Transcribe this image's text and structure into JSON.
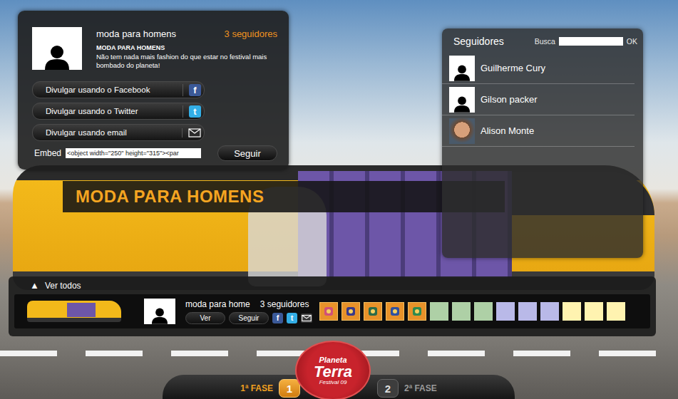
{
  "profile": {
    "name": "moda para homens",
    "followers": "3 seguidores",
    "headline": "MODA PARA HOMENS",
    "description": "Não tem nada mais fashion do que estar no festival mais bombado do planeta!"
  },
  "share_buttons": [
    {
      "label": "Divulgar usando o Facebook",
      "kind": "facebook",
      "glyph": "f",
      "color": "#3b5998"
    },
    {
      "label": "Divulgar usando o Twitter",
      "kind": "twitter",
      "glyph": "t",
      "color": "#33aee6"
    },
    {
      "label": "Divulgar usando email",
      "kind": "email",
      "color": "#2a2a2a"
    }
  ],
  "embed": {
    "label": "Embed",
    "value": "<object width=\"250\" height=\"315\"><par"
  },
  "follow_button": "Seguir",
  "bus_banner": "MODA PARA HOMENS",
  "followers_panel": {
    "title": "Seguidores",
    "search_label": "Busca",
    "search_value": "",
    "ok": "OK",
    "items": [
      {
        "name": "Guilherme Cury",
        "kind": "default"
      },
      {
        "name": "Gilson packer",
        "kind": "default"
      },
      {
        "name": "Alison Monte",
        "kind": "photo"
      }
    ]
  },
  "bottom_bar": {
    "toggle_icon": "▲",
    "toggle_label": "Ver todos",
    "name": "moda para home",
    "followers": "3 seguidores",
    "view_button": "Ver",
    "follow_button": "Seguir",
    "share_icons": [
      {
        "kind": "facebook",
        "glyph": "f",
        "color": "#3b5998"
      },
      {
        "kind": "twitter",
        "glyph": "t",
        "color": "#33aee6"
      },
      {
        "kind": "email",
        "color": "#3a3a3a"
      }
    ],
    "badges": [
      {
        "kind": "icon",
        "color": "#e8922a"
      },
      {
        "kind": "icon",
        "color": "#e8922a"
      },
      {
        "kind": "icon",
        "color": "#e8922a"
      },
      {
        "kind": "icon",
        "color": "#e8922a"
      },
      {
        "kind": "icon",
        "color": "#e8922a"
      },
      {
        "kind": "empty",
        "color": "#aed0a6"
      },
      {
        "kind": "empty",
        "color": "#aed0a6"
      },
      {
        "kind": "empty",
        "color": "#aed0a6"
      },
      {
        "kind": "empty",
        "color": "#b9b9e8"
      },
      {
        "kind": "empty",
        "color": "#b9b9e8"
      },
      {
        "kind": "empty",
        "color": "#b9b9e8"
      },
      {
        "kind": "empty",
        "color": "#fff3b0"
      },
      {
        "kind": "empty",
        "color": "#fff3b0"
      },
      {
        "kind": "empty",
        "color": "#fff3b0"
      }
    ]
  },
  "logo": {
    "line1": "Planeta",
    "line2": "Terra",
    "line3": "Festival",
    "year": "09"
  },
  "phases": [
    {
      "number": "1",
      "label": "1ª FASE",
      "selected": true
    },
    {
      "number": "2",
      "label": "2ª FASE",
      "selected": false
    }
  ]
}
